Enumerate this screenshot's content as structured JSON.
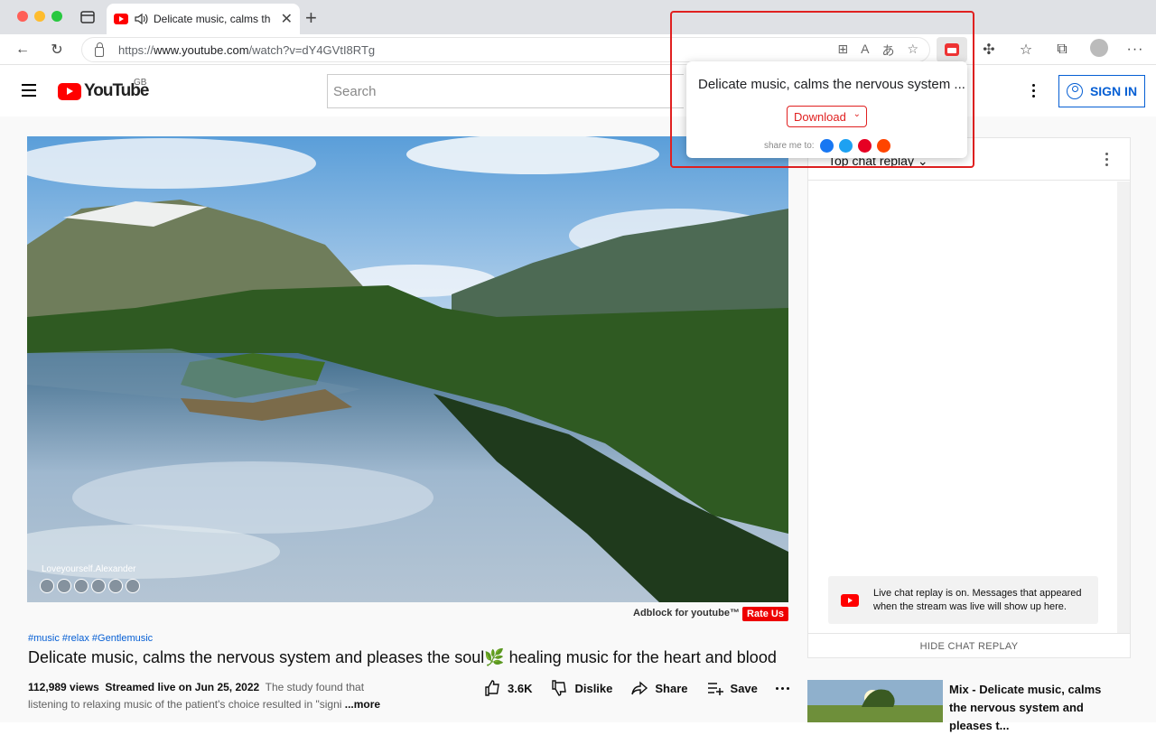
{
  "browser": {
    "tab_title": "Delicate music, calms the",
    "url_prefix": "https://",
    "url_domain": "www.youtube.com",
    "url_path": "/watch?v=dY4GVtI8RTg"
  },
  "header": {
    "logo_text": "YouTube",
    "region": "GB",
    "search_placeholder": "Search",
    "sign_in": "SIGN IN"
  },
  "video": {
    "watermark": "Loveyourself.Alexander",
    "adblock_label": "Adblock for youtube™",
    "rate_us": "Rate Us",
    "hashtags": "#music #relax #Gentlemusic",
    "title": "Delicate music, calms the nervous system and pleases the soul🌿 healing music for the heart and blood",
    "views": "112,989 views",
    "streamed": "Streamed live on Jun 25, 2022",
    "description": "The study found that listening to relaxing music of the patient's choice resulted in \"signi",
    "more": "...more",
    "likes": "3.6K",
    "dislike": "Dislike",
    "share": "Share",
    "save": "Save"
  },
  "chat": {
    "header": "Top chat replay",
    "notice": "Live chat replay is on. Messages that appeared when the stream was live will show up here.",
    "hide": "HIDE CHAT REPLAY"
  },
  "recommendation": {
    "title": "Mix - Delicate music, calms the nervous system and pleases t..."
  },
  "popup": {
    "title": "Delicate music, calms the nervous system ...",
    "download": "Download",
    "share_label": "share me to:",
    "share_targets": [
      "facebook",
      "twitter",
      "pinterest",
      "reddit"
    ]
  },
  "colors": {
    "youtube_red": "#ff0000",
    "link_blue": "#065fd4",
    "popup_red": "#e02020"
  }
}
